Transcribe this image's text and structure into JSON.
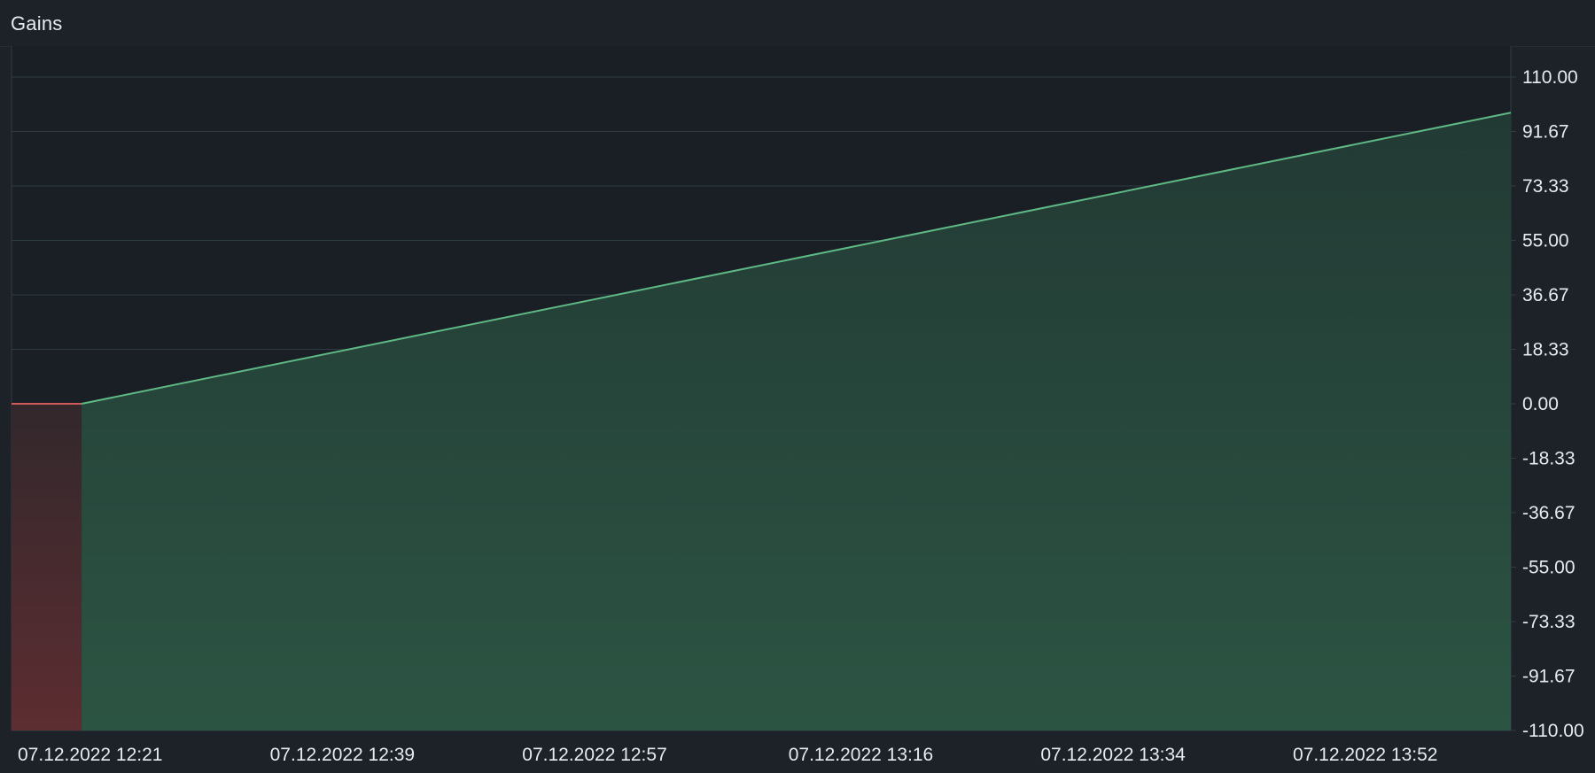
{
  "panel": {
    "title": "Gains"
  },
  "colors": {
    "background": "#1c2228",
    "plot_background": "#1a1f25",
    "grid": "#2f3b44",
    "gain_line": "#5fb985",
    "gain_fill_top": "#223a34",
    "gain_fill_bottom": "#2c5443",
    "loss_line": "#d05a5a",
    "loss_fill_top": "#32282c",
    "loss_fill_bottom": "#5d2d31",
    "text": "#e6ebef"
  },
  "chart_data": {
    "type": "area",
    "title": "Gains",
    "xlabel": "",
    "ylabel": "",
    "ylim": [
      -110,
      110
    ],
    "y_ticks": [
      110,
      91.67,
      73.33,
      55,
      36.67,
      18.33,
      0,
      -18.33,
      -36.67,
      -55,
      -73.33,
      -91.67,
      -110
    ],
    "y_tick_labels": [
      "110.00",
      "91.67",
      "73.33",
      "55.00",
      "36.67",
      "18.33",
      "0.00",
      "-18.33",
      "-36.67",
      "-55.00",
      "-73.33",
      "-91.67",
      "-110.00"
    ],
    "x_tick_labels": [
      "07.12.2022 12:21",
      "07.12.2022 12:39",
      "07.12.2022 12:57",
      "07.12.2022 13:16",
      "07.12.2022 13:34",
      "07.12.2022 13:52"
    ],
    "xlim": [
      "07.12.2022 12:21",
      "07.12.2022 14:08"
    ],
    "x_ticks": [
      "07.12.2022 12:21",
      "07.12.2022 12:39",
      "07.12.2022 12:57",
      "07.12.2022 13:16",
      "07.12.2022 13:34",
      "07.12.2022 13:52"
    ],
    "grid": true,
    "y_axis_position": "right",
    "series": [
      {
        "kind": "loss",
        "points": [
          {
            "x": "07.12.2022 12:21",
            "y": 0
          },
          {
            "x": "07.12.2022 12:26",
            "y": 0
          }
        ]
      },
      {
        "kind": "gain",
        "points": [
          {
            "x": "07.12.2022 12:26",
            "y": 0
          },
          {
            "x": "07.12.2022 14:08",
            "y": 98
          }
        ]
      }
    ]
  }
}
